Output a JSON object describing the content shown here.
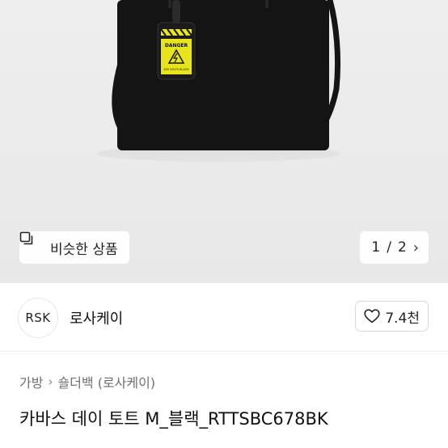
{
  "gallery": {
    "similar_label": "비슷한 상품",
    "current_page": "1",
    "page_sep": "/",
    "total_pages": "2",
    "tag_text": "DANGER",
    "tag_subtext": "400 VOLTS BLACK"
  },
  "shop": {
    "avatar_text": "RSK",
    "name": "로사케이",
    "like_count": "7.4천"
  },
  "product": {
    "breadcrumb": [
      "가방",
      "숄더백 (로사케이)"
    ],
    "title": "카바스 데이 토트 M_블랙_RTTSBC678BK"
  },
  "colors": {
    "bag": "#141414",
    "tag_yellow": "#e8e41a",
    "background": "#ececec"
  }
}
